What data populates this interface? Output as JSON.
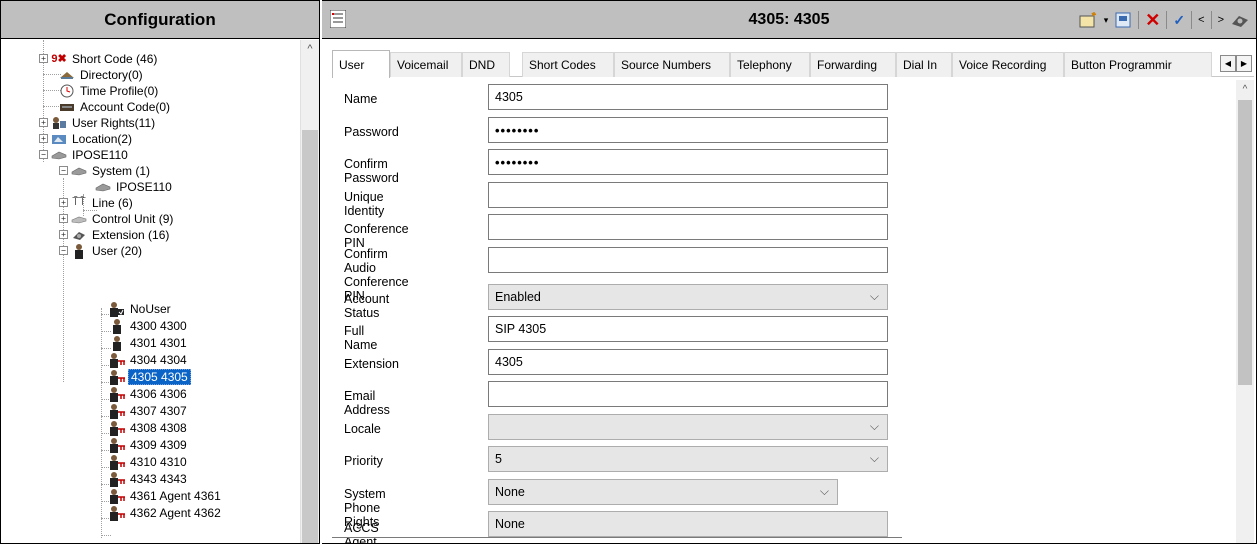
{
  "left_pane": {
    "header": "Configuration",
    "tree": [
      {
        "label": "Short Code (46)",
        "icon": "short-code-icon",
        "expander": "+"
      },
      {
        "label": "Directory(0)",
        "icon": "directory-icon"
      },
      {
        "label": "Time Profile(0)",
        "icon": "clock-icon"
      },
      {
        "label": "Account Code(0)",
        "icon": "account-code-icon"
      },
      {
        "label": "User Rights(11)",
        "icon": "user-rights-icon",
        "expander": "+"
      },
      {
        "label": "Location(2)",
        "icon": "location-icon",
        "expander": "+"
      },
      {
        "label": "IPOSE110",
        "icon": "system-icon",
        "expander": "−"
      },
      {
        "label": "System (1)",
        "icon": "system-icon",
        "expander": "−"
      },
      {
        "label": "IPOSE110",
        "icon": "system-icon"
      },
      {
        "label": "Line (6)",
        "icon": "line-icon",
        "expander": "+"
      },
      {
        "label": "Control Unit (9)",
        "icon": "control-unit-icon",
        "expander": "+"
      },
      {
        "label": "Extension (16)",
        "icon": "extension-icon",
        "expander": "+"
      },
      {
        "label": "User (20)",
        "icon": "user-icon",
        "expander": "−"
      },
      {
        "label": "NoUser",
        "icon": "user-icon"
      },
      {
        "label": "4300 4300",
        "icon": "user-icon"
      },
      {
        "label": "4301 4301",
        "icon": "user-icon"
      },
      {
        "label": "4304 4304",
        "icon": "sip-user-icon"
      },
      {
        "label": "4305 4305",
        "icon": "sip-user-icon",
        "selected": true
      },
      {
        "label": "4306 4306",
        "icon": "sip-user-icon"
      },
      {
        "label": "4307 4307",
        "icon": "sip-user-icon"
      },
      {
        "label": "4308 4308",
        "icon": "sip-user-icon"
      },
      {
        "label": "4309 4309",
        "icon": "sip-user-icon"
      },
      {
        "label": "4310 4310",
        "icon": "sip-user-icon"
      },
      {
        "label": "4343 4343",
        "icon": "sip-user-icon"
      },
      {
        "label": "4361 Agent 4361",
        "icon": "sip-user-icon"
      },
      {
        "label": "4362 Agent 4362",
        "icon": "sip-user-icon"
      }
    ]
  },
  "right_pane": {
    "title": "4305: 4305",
    "tabs": [
      "User",
      "Voicemail",
      "DND",
      "Short Codes",
      "Source Numbers",
      "Telephony",
      "Forwarding",
      "Dial In",
      "Voice Recording",
      "Button Programmir"
    ],
    "active_tab": "User",
    "fields": {
      "name": {
        "label": "Name",
        "value": "4305"
      },
      "password": {
        "label": "Password",
        "value": "••••••••"
      },
      "confirm_password": {
        "label": "Confirm Password",
        "value": "••••••••"
      },
      "unique_identity": {
        "label": "Unique Identity",
        "value": ""
      },
      "conference_pin": {
        "label": "Conference PIN",
        "value": ""
      },
      "confirm_audio_pin": {
        "label": "Confirm Audio Conference PIN",
        "label_line1": "Confirm Audio",
        "label_line2": "Conference PIN",
        "value": ""
      },
      "account_status": {
        "label": "Account Status",
        "value": "Enabled"
      },
      "full_name": {
        "label": "Full Name",
        "value": "SIP 4305"
      },
      "extension": {
        "label": "Extension",
        "value": "4305"
      },
      "email": {
        "label": "Email Address",
        "value": ""
      },
      "locale": {
        "label": "Locale",
        "value": ""
      },
      "priority": {
        "label": "Priority",
        "value": "5"
      },
      "system_phone_rights": {
        "label": "System Phone Rights",
        "value": "None"
      },
      "accs_agent_type": {
        "label": "ACCS Agent Type",
        "value": "None"
      }
    }
  },
  "colors": {
    "header_gray": "#bfbfbf",
    "selection_blue": "#0a64c8",
    "delete_red": "#d00000",
    "ok_blue": "#1f5fbf"
  }
}
